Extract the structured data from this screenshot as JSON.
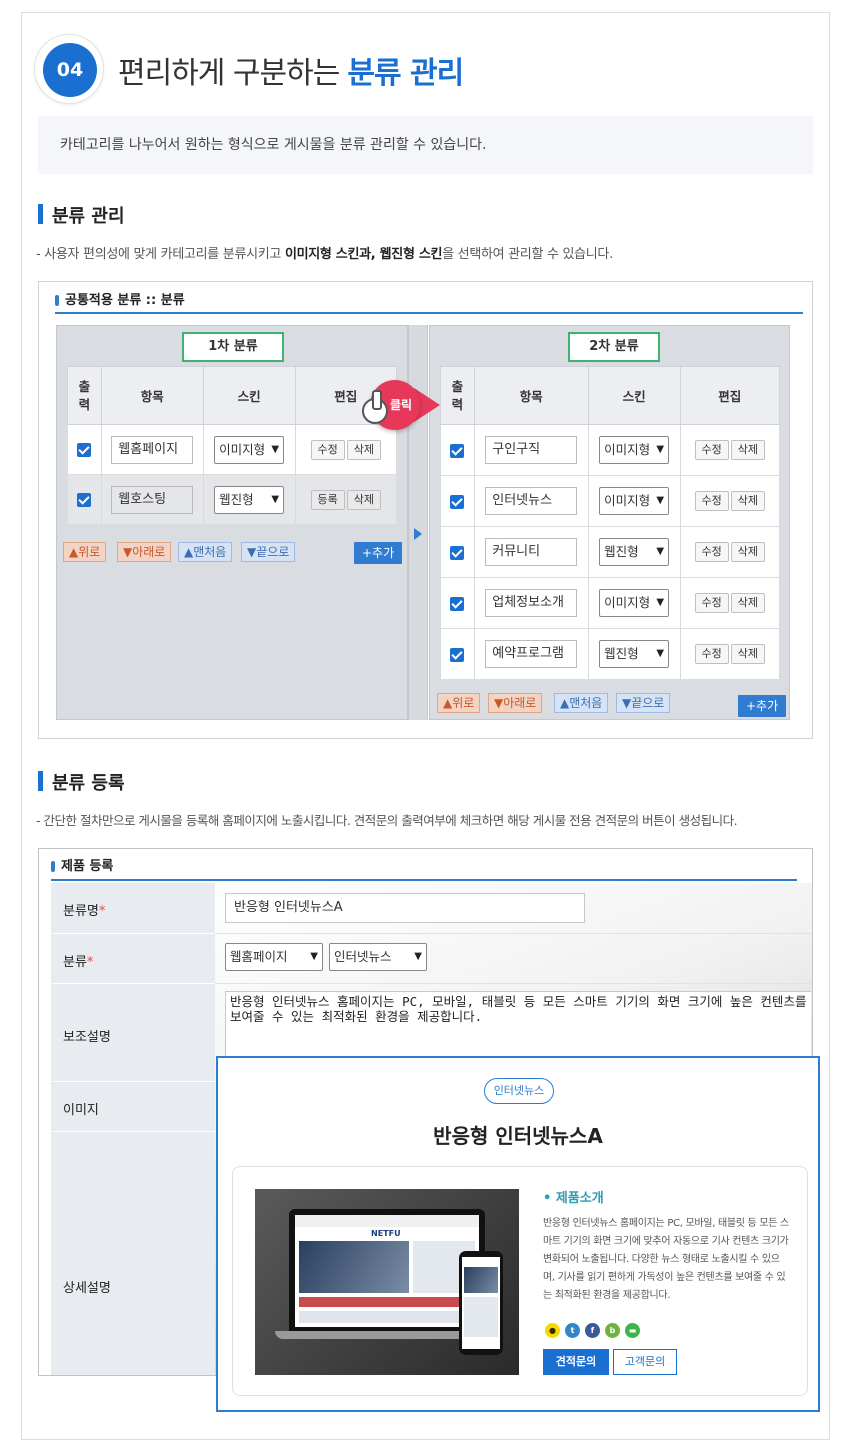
{
  "header": {
    "number": "04",
    "title": "편리하게 구분하는",
    "title_highlight": "분류 관리",
    "intro": "카테고리를 나누어서 원하는 형식으로 게시물을 분류 관리할 수 있습니다."
  },
  "section1": {
    "title": "분류 관리",
    "desc_prefix": "- 사용자 편의성에 맞게 카테고리를 분류시키고 ",
    "desc_bold": "이미지형 스킨과, 웹진형 스킨",
    "desc_suffix": "을 선택하여 관리할 수 있습니다."
  },
  "category_box": {
    "header": "공통적용 분류 :: 분류",
    "click_label": "클릭",
    "nav": {
      "up": "▲위로",
      "down": "▼아래로",
      "first": "▲맨처음",
      "last": "▼끝으로",
      "add": "+추가"
    },
    "primary": {
      "tag": "1차 분류",
      "columns": [
        "출력",
        "항목",
        "스킨",
        "편집"
      ],
      "rows": [
        {
          "item": "웹홈페이지",
          "skin": "이미지형",
          "btn1": "수정",
          "btn2": "삭제"
        },
        {
          "item": "웹호스팅",
          "skin": "웹진형",
          "btn1": "등록",
          "btn2": "삭제"
        }
      ]
    },
    "secondary": {
      "tag": "2차 분류",
      "columns": [
        "출력",
        "항목",
        "스킨",
        "편집"
      ],
      "rows": [
        {
          "item": "구인구직",
          "skin": "이미지형",
          "btn1": "수정",
          "btn2": "삭제"
        },
        {
          "item": "인터넷뉴스",
          "skin": "이미지형",
          "btn1": "수정",
          "btn2": "삭제"
        },
        {
          "item": "커뮤니티",
          "skin": "웹진형",
          "btn1": "수정",
          "btn2": "삭제"
        },
        {
          "item": "업체정보소개",
          "skin": "이미지형",
          "btn1": "수정",
          "btn2": "삭제"
        },
        {
          "item": "예약프로그램",
          "skin": "웹진형",
          "btn1": "수정",
          "btn2": "삭제"
        }
      ]
    }
  },
  "section2": {
    "title": "분류 등록",
    "desc": "- 간단한 절차만으로 게시물을 등록해 홈페이지에 노출시킵니다. 견적문의 출력여부에 체크하면 해당 게시물 전용 견적문의 버튼이 생성됩니다."
  },
  "product_box": {
    "header": "제품 등록",
    "labels": {
      "name": "분류명",
      "category": "분류",
      "sub_desc": "보조설명",
      "image": "이미지",
      "detail": "상세설명",
      "required": "*"
    },
    "name_value": "반응형 인터넷뉴스A",
    "category1": "웹홈페이지",
    "category2": "인터넷뉴스",
    "sub_desc_value": "반응형 인터넷뉴스 홈페이지는 PC, 모바일, 태블릿 등 모든 스마트 기기의 화면 크기에 높은 컨텐츠를 보여줄 수 있는 최적화된 환경을 제공합니다."
  },
  "zoom_card": {
    "badge": "인터넷뉴스",
    "title": "반응형 인터넷뉴스A",
    "screen_logo": "NETFU",
    "sub_title": "• 제품소개",
    "text": "반응형 인터넷뉴스 홈페이지는 PC, 모바일, 태블릿 등 모든 스마트 기기의 화면 크기에 맞추어 자동으로 기사 컨텐츠 크기가 변화되어 노출됩니다. 다양한 뉴스 형태로 노출시킬 수 있으며, 기사를 읽기 편하게 가독성이 높은 컨텐츠를 보여줄 수 있는 최적화된 환경을 제공합니다.",
    "btn_estimate": "견적문의",
    "btn_support": "고객문의",
    "sns": [
      {
        "name": "kakaotalk-icon",
        "color": "#f7d800"
      },
      {
        "name": "twitter-icon",
        "color": "#2f86c9"
      },
      {
        "name": "facebook-icon",
        "color": "#3b5998"
      },
      {
        "name": "kakaostory-icon",
        "color": "#6fb33f"
      },
      {
        "name": "line-icon",
        "color": "#3bb44a"
      }
    ]
  }
}
